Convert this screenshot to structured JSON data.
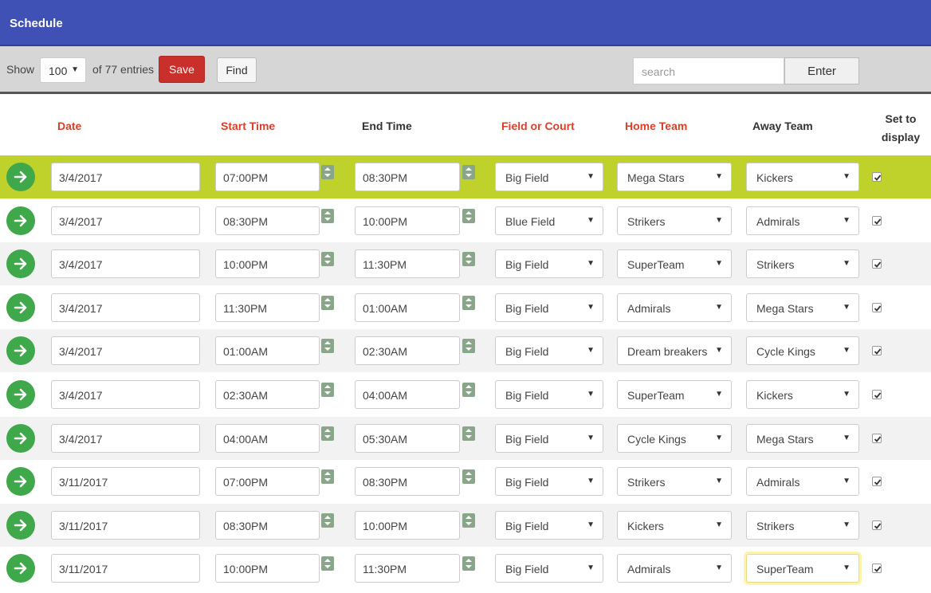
{
  "header": {
    "title": "Schedule"
  },
  "toolbar": {
    "show_label": "Show",
    "page_size": "100",
    "entries_label": "of 77 entries",
    "save_label": "Save",
    "find_label": "Find",
    "search_placeholder": "search",
    "enter_label": "Enter"
  },
  "columns": {
    "date": "Date",
    "start": "Start Time",
    "end": "End Time",
    "field": "Field or Court",
    "home": "Home Team",
    "away": "Away Team",
    "display_line1": "Set to",
    "display_line2": "display"
  },
  "colors": {
    "header": "#3f51b5",
    "highlight_row": "#bfd22b",
    "save": "#c9302c",
    "required_header": "#d9412b"
  },
  "rows": [
    {
      "date": "3/4/2017",
      "start": "07:00PM",
      "end": "08:30PM",
      "field": "Big Field",
      "home": "Mega Stars",
      "away": "Kickers",
      "display": true
    },
    {
      "date": "3/4/2017",
      "start": "08:30PM",
      "end": "10:00PM",
      "field": "Blue Field",
      "home": "Strikers",
      "away": "Admirals",
      "display": true
    },
    {
      "date": "3/4/2017",
      "start": "10:00PM",
      "end": "11:30PM",
      "field": "Big Field",
      "home": "SuperTeam",
      "away": "Strikers",
      "display": true
    },
    {
      "date": "3/4/2017",
      "start": "11:30PM",
      "end": "01:00AM",
      "field": "Big Field",
      "home": "Admirals",
      "away": "Mega Stars",
      "display": true
    },
    {
      "date": "3/4/2017",
      "start": "01:00AM",
      "end": "02:30AM",
      "field": "Big Field",
      "home": "Dream breakers",
      "away": "Cycle Kings",
      "display": true
    },
    {
      "date": "3/4/2017",
      "start": "02:30AM",
      "end": "04:00AM",
      "field": "Big Field",
      "home": "SuperTeam",
      "away": "Kickers",
      "display": true
    },
    {
      "date": "3/4/2017",
      "start": "04:00AM",
      "end": "05:30AM",
      "field": "Big Field",
      "home": "Cycle Kings",
      "away": "Mega Stars",
      "display": true
    },
    {
      "date": "3/11/2017",
      "start": "07:00PM",
      "end": "08:30PM",
      "field": "Big Field",
      "home": "Strikers",
      "away": "Admirals",
      "display": true
    },
    {
      "date": "3/11/2017",
      "start": "08:30PM",
      "end": "10:00PM",
      "field": "Big Field",
      "home": "Kickers",
      "away": "Strikers",
      "display": true
    },
    {
      "date": "3/11/2017",
      "start": "10:00PM",
      "end": "11:30PM",
      "field": "Big Field",
      "home": "Admirals",
      "away": "SuperTeam",
      "display": true
    }
  ]
}
